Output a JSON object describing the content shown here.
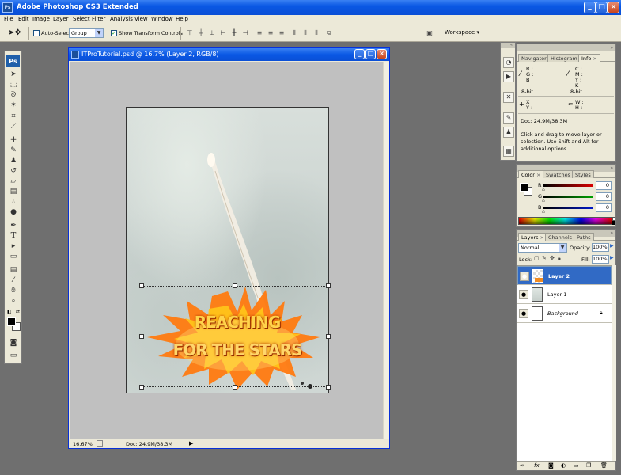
{
  "app": {
    "title": "Adobe Photoshop CS3 Extended",
    "icon_text": "Ps",
    "window_buttons": [
      "_",
      "□",
      "×"
    ]
  },
  "menu": [
    "File",
    "Edit",
    "Image",
    "Layer",
    "Select",
    "Filter",
    "Analysis",
    "View",
    "Window",
    "Help"
  ],
  "options": {
    "auto_select_label": "Auto-Select:",
    "auto_select_checked": false,
    "auto_select_value": "Group",
    "show_transform_label": "Show Transform Controls",
    "show_transform_checked": true,
    "workspace_label": "Workspace ▾"
  },
  "toolbox": {
    "logo": "Ps",
    "tools": [
      "move-icon",
      "marquee-icon",
      "lasso-icon",
      "magic-wand-icon",
      "crop-icon",
      "slice-icon",
      "healing-icon",
      "brush-icon",
      "clone-stamp-icon",
      "history-brush-icon",
      "eraser-icon",
      "gradient-icon",
      "blur-icon",
      "dodge-icon",
      "pen-icon",
      "type-icon",
      "path-select-icon",
      "shape-icon",
      "notes-icon",
      "eyedropper-icon",
      "hand-icon",
      "zoom-icon"
    ]
  },
  "document": {
    "title": "ITProTutorial.psd @ 16.7% (Layer 2, RGB/8)",
    "zoom": "16.67%",
    "doc_size": "Doc: 24.9M/38.3M",
    "artwork_line1": "REACHING",
    "artwork_line2": "FOR THE STARS"
  },
  "info_panel": {
    "tabs": [
      "Navigator",
      "Histogram",
      "Info"
    ],
    "active_tab": "Info",
    "rgb_labels": [
      "R :",
      "G :",
      "B :"
    ],
    "cmyk_labels": [
      "C :",
      "M :",
      "Y :",
      "K :"
    ],
    "bitdepth_left": "8-bit",
    "bitdepth_right": "8-bit",
    "xy_labels": [
      "X :",
      "Y :"
    ],
    "wh_labels": [
      "W :",
      "H :"
    ],
    "doc_size": "Doc: 24.9M/38.3M",
    "hint": "Click and drag to move layer or selection.  Use Shift and Alt for additional options."
  },
  "color_panel": {
    "tabs": [
      "Color",
      "Swatches",
      "Styles"
    ],
    "active_tab": "Color",
    "channels": [
      {
        "label": "R",
        "value": "0",
        "color": "#d60000"
      },
      {
        "label": "G",
        "value": "0",
        "color": "#00a000"
      },
      {
        "label": "B",
        "value": "0",
        "color": "#0018c8"
      }
    ]
  },
  "layers_panel": {
    "tabs": [
      "Layers",
      "Channels",
      "Paths"
    ],
    "active_tab": "Layers",
    "blend_mode": "Normal",
    "opacity_label": "Opacity:",
    "opacity_value": "100%",
    "lock_label": "Lock:",
    "fill_label": "Fill:",
    "fill_value": "100%",
    "layers": [
      {
        "name": "Layer 2",
        "selected": true
      },
      {
        "name": "Layer 1",
        "selected": false
      },
      {
        "name": "Background",
        "selected": false,
        "locked": true
      }
    ]
  },
  "colors": {
    "accent": "#316ac5",
    "titlebar": "#0a58e4",
    "chrome": "#ece9d8",
    "workspace": "#6f6f6f"
  }
}
